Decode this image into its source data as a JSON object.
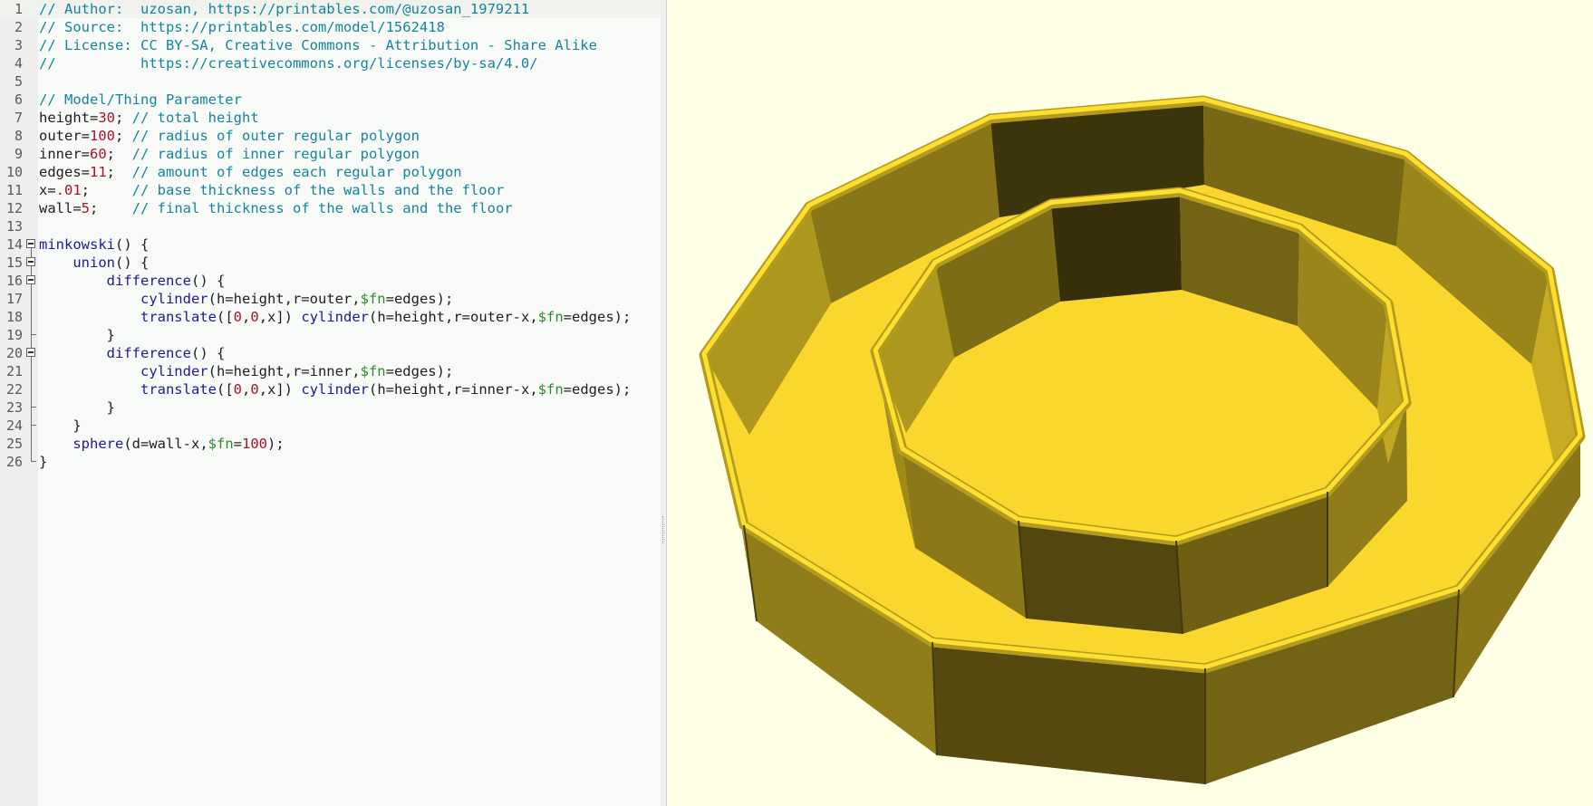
{
  "editor": {
    "current_line": 1,
    "lines": [
      {
        "n": "1",
        "fold": "none",
        "tokens": [
          [
            "cm",
            "// Author:  uzosan, https://printables.com/@uzosan_1979211"
          ]
        ]
      },
      {
        "n": "2",
        "fold": "none",
        "tokens": [
          [
            "cm",
            "// Source:  https://printables.com/model/1562418"
          ]
        ]
      },
      {
        "n": "3",
        "fold": "none",
        "tokens": [
          [
            "cm",
            "// License: CC BY-SA, Creative Commons - Attribution - Share Alike"
          ]
        ]
      },
      {
        "n": "4",
        "fold": "none",
        "tokens": [
          [
            "cm",
            "//          https://creativecommons.org/licenses/by-sa/4.0/"
          ]
        ]
      },
      {
        "n": "5",
        "fold": "none",
        "tokens": []
      },
      {
        "n": "6",
        "fold": "none",
        "tokens": [
          [
            "cm",
            "// Model/Thing Parameter"
          ]
        ]
      },
      {
        "n": "7",
        "fold": "none",
        "tokens": [
          [
            "op",
            "height="
          ],
          [
            "nm",
            "30"
          ],
          [
            "op",
            "; "
          ],
          [
            "cm",
            "// total height"
          ]
        ]
      },
      {
        "n": "8",
        "fold": "none",
        "tokens": [
          [
            "op",
            "outer="
          ],
          [
            "nm",
            "100"
          ],
          [
            "op",
            "; "
          ],
          [
            "cm",
            "// radius of outer regular polygon"
          ]
        ]
      },
      {
        "n": "9",
        "fold": "none",
        "tokens": [
          [
            "op",
            "inner="
          ],
          [
            "nm",
            "60"
          ],
          [
            "op",
            ";  "
          ],
          [
            "cm",
            "// radius of inner regular polygon"
          ]
        ]
      },
      {
        "n": "10",
        "fold": "none",
        "tokens": [
          [
            "op",
            "edges="
          ],
          [
            "nm",
            "11"
          ],
          [
            "op",
            ";  "
          ],
          [
            "cm",
            "// amount of edges each regular polygon"
          ]
        ]
      },
      {
        "n": "11",
        "fold": "none",
        "tokens": [
          [
            "op",
            "x="
          ],
          [
            "nm",
            ".01"
          ],
          [
            "op",
            ";     "
          ],
          [
            "cm",
            "// base thickness of the walls and the floor"
          ]
        ]
      },
      {
        "n": "12",
        "fold": "none",
        "tokens": [
          [
            "op",
            "wall="
          ],
          [
            "nm",
            "5"
          ],
          [
            "op",
            ";    "
          ],
          [
            "cm",
            "// final thickness of the walls and the floor"
          ]
        ]
      },
      {
        "n": "13",
        "fold": "none",
        "tokens": []
      },
      {
        "n": "14",
        "fold": "open",
        "tokens": [
          [
            "kw",
            "minkowski"
          ],
          [
            "op",
            "() {"
          ]
        ]
      },
      {
        "n": "15",
        "fold": "open",
        "tokens": [
          [
            "op",
            "    "
          ],
          [
            "kw",
            "union"
          ],
          [
            "op",
            "() {"
          ]
        ]
      },
      {
        "n": "16",
        "fold": "open",
        "tokens": [
          [
            "op",
            "        "
          ],
          [
            "kw",
            "difference"
          ],
          [
            "op",
            "() {"
          ]
        ]
      },
      {
        "n": "17",
        "fold": "line",
        "tokens": [
          [
            "op",
            "            "
          ],
          [
            "kw",
            "cylinder"
          ],
          [
            "op",
            "(h=height,r=outer,"
          ],
          [
            "sv",
            "$fn"
          ],
          [
            "op",
            "=edges);"
          ]
        ]
      },
      {
        "n": "18",
        "fold": "line",
        "tokens": [
          [
            "op",
            "            "
          ],
          [
            "kw",
            "translate"
          ],
          [
            "op",
            "(["
          ],
          [
            "nm",
            "0"
          ],
          [
            "op",
            ","
          ],
          [
            "nm",
            "0"
          ],
          [
            "op",
            ",x]) "
          ],
          [
            "kw",
            "cylinder"
          ],
          [
            "op",
            "(h=height,r=outer-x,"
          ],
          [
            "sv",
            "$fn"
          ],
          [
            "op",
            "=edges);"
          ]
        ]
      },
      {
        "n": "19",
        "fold": "end",
        "tokens": [
          [
            "op",
            "        }"
          ]
        ]
      },
      {
        "n": "20",
        "fold": "open",
        "tokens": [
          [
            "op",
            "        "
          ],
          [
            "kw",
            "difference"
          ],
          [
            "op",
            "() {"
          ]
        ]
      },
      {
        "n": "21",
        "fold": "line",
        "tokens": [
          [
            "op",
            "            "
          ],
          [
            "kw",
            "cylinder"
          ],
          [
            "op",
            "(h=height,r=inner,"
          ],
          [
            "sv",
            "$fn"
          ],
          [
            "op",
            "=edges);"
          ]
        ]
      },
      {
        "n": "22",
        "fold": "line",
        "tokens": [
          [
            "op",
            "            "
          ],
          [
            "kw",
            "translate"
          ],
          [
            "op",
            "(["
          ],
          [
            "nm",
            "0"
          ],
          [
            "op",
            ","
          ],
          [
            "nm",
            "0"
          ],
          [
            "op",
            ",x]) "
          ],
          [
            "kw",
            "cylinder"
          ],
          [
            "op",
            "(h=height,r=inner-x,"
          ],
          [
            "sv",
            "$fn"
          ],
          [
            "op",
            "=edges);"
          ]
        ]
      },
      {
        "n": "23",
        "fold": "end",
        "tokens": [
          [
            "op",
            "        }"
          ]
        ]
      },
      {
        "n": "24",
        "fold": "end",
        "tokens": [
          [
            "op",
            "    }"
          ]
        ]
      },
      {
        "n": "25",
        "fold": "line",
        "tokens": [
          [
            "op",
            "    "
          ],
          [
            "kw",
            "sphere"
          ],
          [
            "op",
            "(d=wall-x,"
          ],
          [
            "sv",
            "$fn"
          ],
          [
            "op",
            "="
          ],
          [
            "nm",
            "100"
          ],
          [
            "op",
            ");"
          ]
        ]
      },
      {
        "n": "26",
        "fold": "end",
        "tokens": [
          [
            "op",
            "}"
          ]
        ]
      }
    ]
  },
  "viewport": {
    "background": "#ffffe5",
    "model_color": "#f9d72c",
    "edges": 11
  }
}
